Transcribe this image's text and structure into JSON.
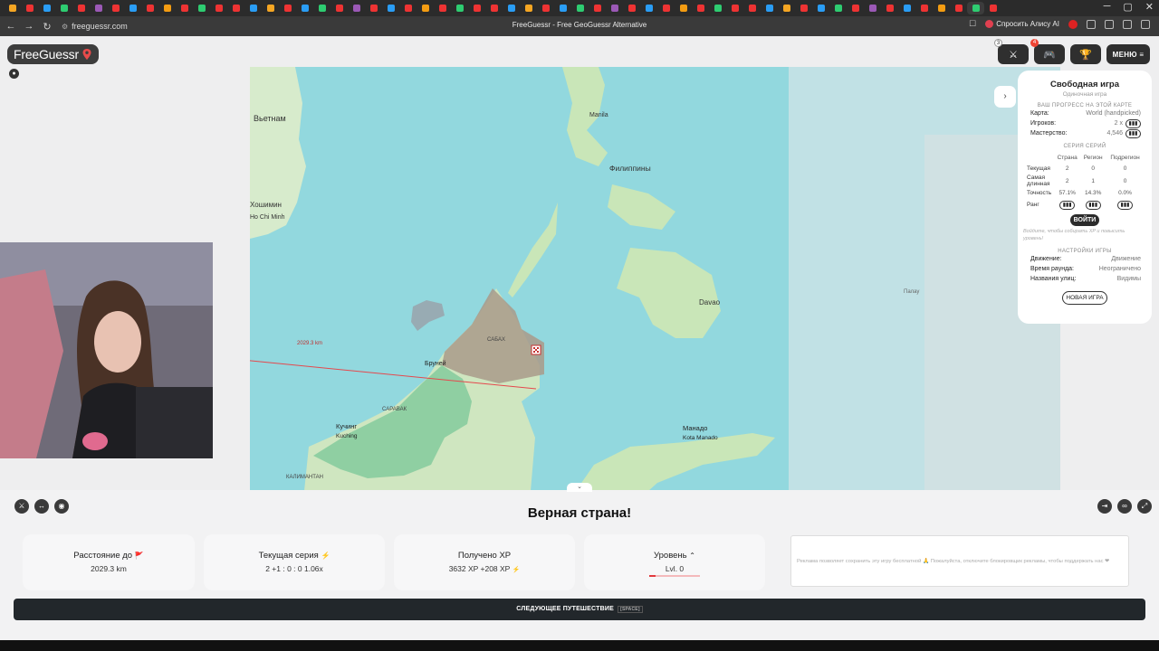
{
  "browser": {
    "url": "freeguessr.com",
    "page_title": "FreeGuessr - Free GeoGuessr Alternative",
    "alice_label": "Спросить Алису AI"
  },
  "app": {
    "logo": "FreeGuessr",
    "menu_label": "МЕНЮ",
    "top_badges": [
      "3",
      "4"
    ]
  },
  "map": {
    "labels": {
      "vietnam": "Вьетнам",
      "hcmc": "Хошимин",
      "hcmc_en": "Ho Chi Minh",
      "philippines": "Филиппины",
      "manila": "Manila",
      "brunei": "Бруней",
      "kuching": "Кучинг",
      "kuching_en": "Kuching",
      "sarawak": "САРАВАК",
      "sabah": "САБАХ",
      "davao": "Davao",
      "manado": "Манадо",
      "manado_en": "Kota Manado",
      "kalimantan": "КАЛИМАНТАН",
      "palau": "Палау",
      "distance_line": "2029.3 km"
    }
  },
  "panel": {
    "title": "Свободная игра",
    "subtitle": "Одиночная игра",
    "progress_header": "ВАШ ПРОГРЕСС НА ЭТОЙ КАРТЕ",
    "map_label": "Карта:",
    "map_value": "World (handpicked)",
    "players_label": "Игроков:",
    "players_value": "2 x",
    "mastery_label": "Мастерство:",
    "mastery_value": "4,546",
    "series_header": "СЕРИЯ СЕРИЙ",
    "series_cols": [
      "Страна",
      "Регион",
      "Подрегион"
    ],
    "series_rows": [
      {
        "name": "Текущая",
        "vals": [
          "2",
          "0",
          "0"
        ]
      },
      {
        "name": "Самая длинная",
        "vals": [
          "2",
          "1",
          "0"
        ]
      },
      {
        "name": "Точность",
        "vals": [
          "57.1%",
          "14.3%",
          "0.0%"
        ]
      },
      {
        "name": "Ранг",
        "vals": [
          "",
          "",
          ""
        ]
      }
    ],
    "login": "ВОЙТИ",
    "login_hint": "Войдите, чтобы собирать XP и повысить уровень!",
    "settings_header": "НАСТРОЙКИ ИГРЫ",
    "settings": [
      {
        "k": "Движение:",
        "v": "Движение"
      },
      {
        "k": "Время раунда:",
        "v": "Неограничено"
      },
      {
        "k": "Названия улиц:",
        "v": "Видимы"
      }
    ],
    "new_game": "НОВАЯ ИГРА"
  },
  "result": {
    "title": "Верная страна!",
    "cards": [
      {
        "label": "Расстояние до",
        "value": "2029.3 km",
        "icon": "🚩"
      },
      {
        "label": "Текущая серия",
        "value": "2 +1 : 0 : 0  1.06x",
        "icon": "⚡"
      },
      {
        "label": "Получено XP",
        "value": "3632 XP  +208 XP",
        "icon": "⚡"
      },
      {
        "label": "Уровень",
        "value": "Lvl. 0",
        "icon": "⌃"
      }
    ],
    "level_progress": 0.12,
    "ad_text": "Реклама позволяет сохранить эту игру бесплатной 🙏 Пожалуйста, отключите блокировщик рекламы, чтобы поддержать нас ❤",
    "next_button": "СЛЕДУЮЩЕЕ ПУТЕШЕСТВИЕ",
    "next_key": "[SPACE]"
  }
}
